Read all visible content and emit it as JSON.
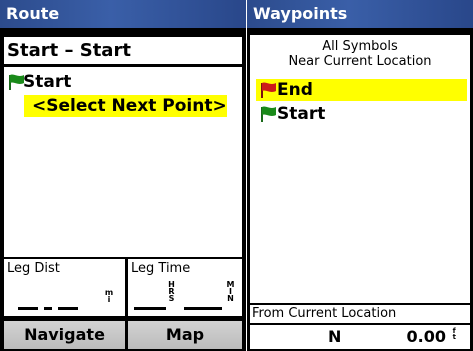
{
  "route": {
    "title": "Route",
    "header": "Start – Start",
    "items": [
      {
        "label": "Start",
        "flag": "green-flag-icon"
      },
      {
        "label": "<Select Next Point>"
      }
    ],
    "leg_dist": {
      "label": "Leg Dist",
      "value": "__.__",
      "unit": "mi"
    },
    "leg_time": {
      "label": "Leg Time",
      "value": "__:__",
      "unit_left": "HRS",
      "unit_right": "MIN"
    },
    "buttons": {
      "navigate": "Navigate",
      "map": "Map"
    }
  },
  "waypoints": {
    "title": "Waypoints",
    "filter_line1": "All Symbols",
    "filter_line2": "Near Current Location",
    "items": [
      {
        "label": "End",
        "flag": "red-flag-icon",
        "selected": true
      },
      {
        "label": "Start",
        "flag": "green-flag-icon",
        "selected": false
      }
    ],
    "from_label": "From Current Location",
    "direction": "N",
    "distance": "0.00",
    "distance_unit": "ft"
  },
  "colors": {
    "titlebar": "#3a5fa8",
    "highlight": "#ffff00",
    "flag_green": "#1a8a1a",
    "flag_red": "#cc1a1a"
  }
}
